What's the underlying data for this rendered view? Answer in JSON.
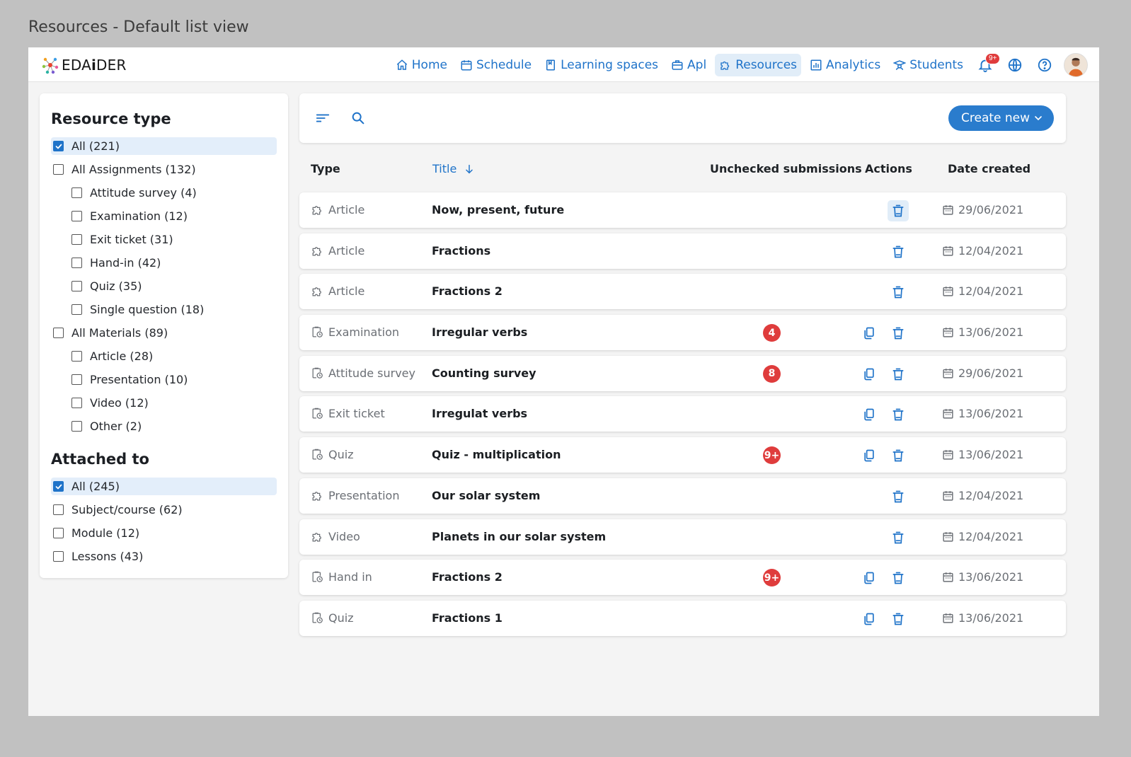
{
  "caption": "Resources - Default list view",
  "logo": {
    "text_prefix": "EDA",
    "text_mid": "i",
    "text_suffix": "DER"
  },
  "nav": {
    "items": [
      {
        "label": "Home",
        "icon": "home-icon"
      },
      {
        "label": "Schedule",
        "icon": "calendar-icon"
      },
      {
        "label": "Learning spaces",
        "icon": "book-icon"
      },
      {
        "label": "Apl",
        "icon": "briefcase-icon"
      },
      {
        "label": "Resources",
        "icon": "puzzle-icon",
        "active": true
      },
      {
        "label": "Analytics",
        "icon": "chart-icon"
      },
      {
        "label": "Students",
        "icon": "student-icon"
      }
    ],
    "notifications_badge": "9+"
  },
  "sidebar": {
    "resource_type_title": "Resource type",
    "resource_types": [
      {
        "label": "All (221)",
        "checked": true,
        "level": 0
      },
      {
        "label": "All Assignments (132)",
        "checked": false,
        "level": 0
      },
      {
        "label": "Attitude survey (4)",
        "checked": false,
        "level": 1
      },
      {
        "label": "Examination (12)",
        "checked": false,
        "level": 1
      },
      {
        "label": "Exit ticket (31)",
        "checked": false,
        "level": 1
      },
      {
        "label": "Hand-in (42)",
        "checked": false,
        "level": 1
      },
      {
        "label": "Quiz (35)",
        "checked": false,
        "level": 1
      },
      {
        "label": "Single question (18)",
        "checked": false,
        "level": 1
      },
      {
        "label": "All Materials (89)",
        "checked": false,
        "level": 0
      },
      {
        "label": "Article (28)",
        "checked": false,
        "level": 1
      },
      {
        "label": "Presentation (10)",
        "checked": false,
        "level": 1
      },
      {
        "label": "Video (12)",
        "checked": false,
        "level": 1
      },
      {
        "label": "Other (2)",
        "checked": false,
        "level": 1
      }
    ],
    "attached_to_title": "Attached to",
    "attached_to": [
      {
        "label": "All (245)",
        "checked": true,
        "level": 0
      },
      {
        "label": "Subject/course (62)",
        "checked": false,
        "level": 0
      },
      {
        "label": "Module (12)",
        "checked": false,
        "level": 0
      },
      {
        "label": "Lessons (43)",
        "checked": false,
        "level": 0
      }
    ]
  },
  "toolbar": {
    "create_label": "Create new"
  },
  "table": {
    "headers": {
      "type": "Type",
      "title": "Title",
      "unchecked": "Unchecked submissions",
      "actions": "Actions",
      "date": "Date created"
    },
    "rows": [
      {
        "type": "Article",
        "kind": "material",
        "title": "Now, present, future",
        "badge": "",
        "copy": false,
        "date": "29/06/2021",
        "highlight_trash": true
      },
      {
        "type": "Article",
        "kind": "material",
        "title": "Fractions",
        "badge": "",
        "copy": false,
        "date": "12/04/2021"
      },
      {
        "type": "Article",
        "kind": "material",
        "title": "Fractions 2",
        "badge": "",
        "copy": false,
        "date": "12/04/2021"
      },
      {
        "type": "Examination",
        "kind": "assignment",
        "title": "Irregular verbs",
        "badge": "4",
        "copy": true,
        "date": "13/06/2021"
      },
      {
        "type": "Attitude survey",
        "kind": "assignment",
        "title": "Counting survey",
        "badge": "8",
        "copy": true,
        "date": "29/06/2021"
      },
      {
        "type": "Exit ticket",
        "kind": "assignment",
        "title": "Irregulat verbs",
        "badge": "",
        "copy": true,
        "date": "13/06/2021"
      },
      {
        "type": "Quiz",
        "kind": "assignment",
        "title": "Quiz - multiplication",
        "badge": "9+",
        "copy": true,
        "date": "13/06/2021"
      },
      {
        "type": "Presentation",
        "kind": "material",
        "title": "Our solar system",
        "badge": "",
        "copy": false,
        "date": "12/04/2021"
      },
      {
        "type": "Video",
        "kind": "material",
        "title": "Planets in our solar system",
        "badge": "",
        "copy": false,
        "date": "12/04/2021"
      },
      {
        "type": "Hand in",
        "kind": "assignment",
        "title": "Fractions 2",
        "badge": "9+",
        "copy": true,
        "date": "13/06/2021"
      },
      {
        "type": "Quiz",
        "kind": "assignment",
        "title": "Fractions 1",
        "badge": "",
        "copy": true,
        "date": "13/06/2021"
      }
    ]
  },
  "colors": {
    "accent": "#1f73c9",
    "badge": "#df3c3c",
    "active_bg": "#e1edf8"
  }
}
